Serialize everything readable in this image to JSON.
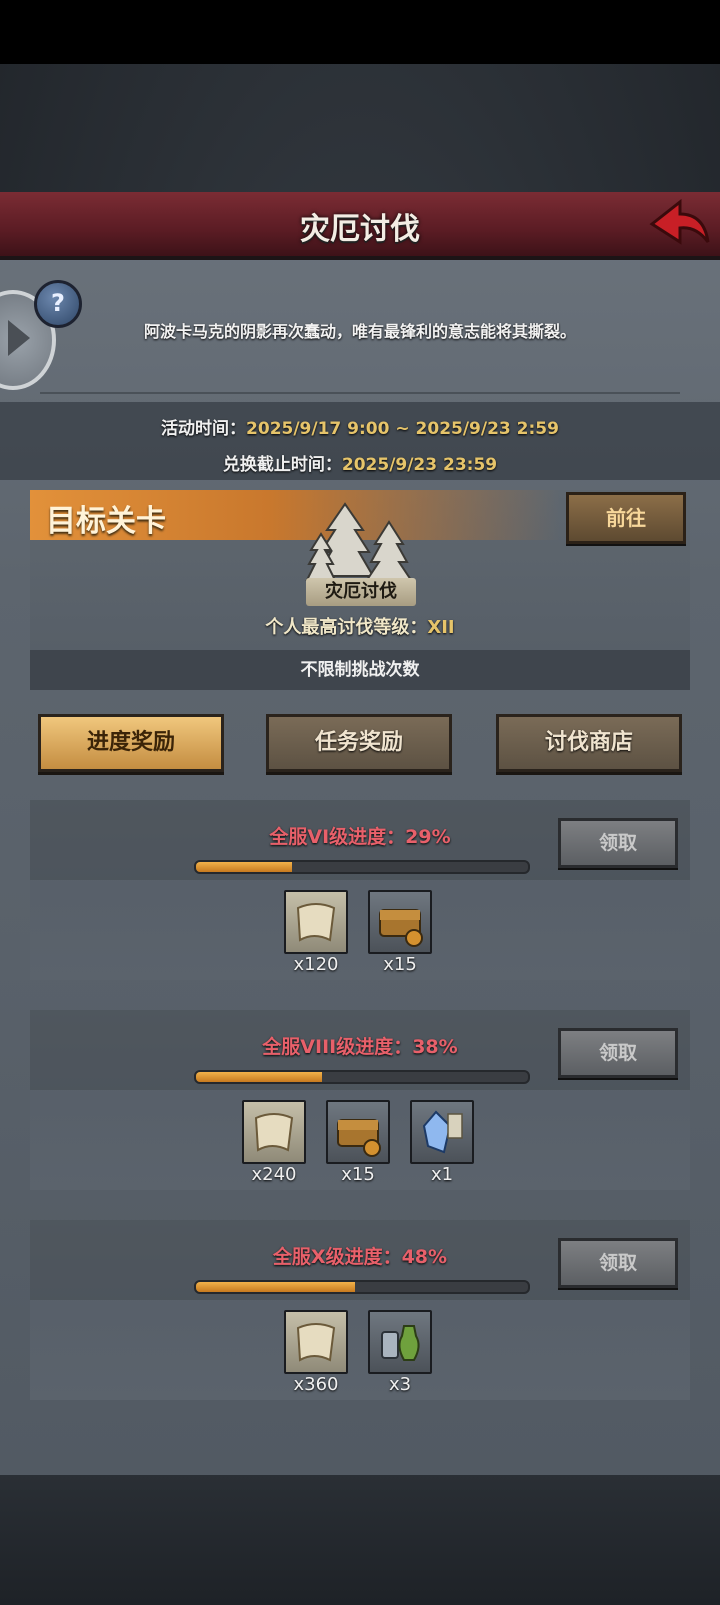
{
  "header": {
    "title": "灾厄讨伐"
  },
  "description": "阿波卡马克的阴影再次蠢动，唯有最锋利的意志能将其撕裂。",
  "times": {
    "activity_label": "活动时间：",
    "activity_value": "2025/9/17 9:00 ~ 2025/9/23 2:59",
    "exchange_label": "兑换截止时间：",
    "exchange_value": "2025/9/23 23:59"
  },
  "target": {
    "title": "目标关卡",
    "go_label": "前往",
    "stage_name": "灾厄讨伐",
    "best_label": "个人最高讨伐等级：",
    "best_value": "XII",
    "unlimited": "不限制挑战次数"
  },
  "tabs": [
    {
      "label": "进度奖励",
      "active": true
    },
    {
      "label": "任务奖励",
      "active": false
    },
    {
      "label": "讨伐商店",
      "active": false
    }
  ],
  "rewards": [
    {
      "title": "全服VI级进度：29%",
      "progress": 0.29,
      "claim_label": "领取",
      "items": [
        {
          "icon": "scroll-icon",
          "qty": "x120"
        },
        {
          "icon": "chest-icon",
          "qty": "x15"
        }
      ]
    },
    {
      "title": "全服VIII级进度：38%",
      "progress": 0.38,
      "claim_label": "领取",
      "items": [
        {
          "icon": "scroll-icon",
          "qty": "x240"
        },
        {
          "icon": "chest-icon",
          "qty": "x15"
        },
        {
          "icon": "crystal-icon",
          "qty": "x1"
        }
      ]
    },
    {
      "title": "全服X级进度：48%",
      "progress": 0.48,
      "claim_label": "领取",
      "items": [
        {
          "icon": "scroll-icon",
          "qty": "x360"
        },
        {
          "icon": "potion-icon",
          "qty": "x3"
        }
      ]
    }
  ],
  "colors": {
    "accent_orange": "#e2913a",
    "title_red": "#5b1c24",
    "progress_text": "#e8606a",
    "gold_text": "#e6c46a"
  }
}
